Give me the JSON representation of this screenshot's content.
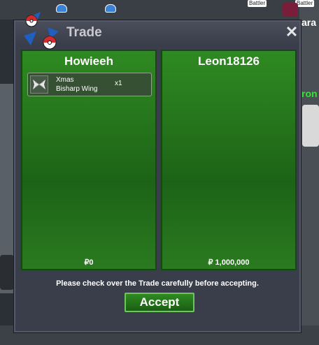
{
  "window": {
    "title": "Trade",
    "close_glyph": "✕"
  },
  "players": [
    {
      "name": "Howieeh",
      "money": "₽0",
      "items": [
        {
          "name": "Xmas Bisharp Wing",
          "name_line1": "Xmas",
          "name_line2": "Bisharp Wing",
          "qty": "x1",
          "icon": "wing-icon"
        }
      ]
    },
    {
      "name": "Leon18126",
      "money": "₽ 1,000,000",
      "items": []
    }
  ],
  "notice": "Please check over the Trade carefully before accepting.",
  "accept_label": "Accept",
  "background": {
    "tags": [
      "Battler",
      "Battler"
    ],
    "fragments": [
      "ara",
      "ron"
    ]
  },
  "colors": {
    "panel_green": "#1d6317",
    "window_bg": "#3a3d4a",
    "logo_blue": "#1f5fbf",
    "logo_red": "#d22b2b"
  }
}
